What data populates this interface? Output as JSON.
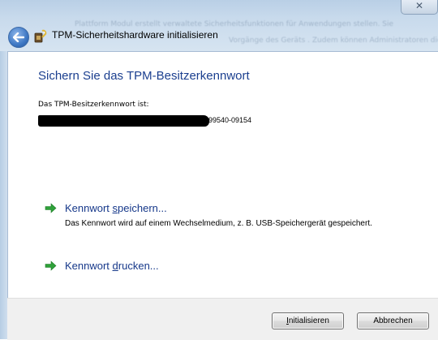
{
  "window": {
    "title": "TPM-Sicherheitshardware initialisieren",
    "background_blur_line1": "Plattform Modul erstellt verwaltete Sicherheitsfunktionen für Anwendungen stellen. Sie",
    "background_blur_line2": "Vorgänge des Geräts . Zudem können Administratoren die die Verwendung"
  },
  "header": {
    "heading": "Sichern Sie das TPM-Besitzerkennwort"
  },
  "password": {
    "label": "Das TPM-Besitzerkennwort ist:",
    "visible_suffix": "99540-09154"
  },
  "commands": [
    {
      "prefix": "Kennwort ",
      "accel": "s",
      "suffix": "peichern...",
      "description": "Das Kennwort wird auf einem Wechselmedium, z. B. USB-Speichergerät gespeichert."
    },
    {
      "prefix": "Kennwort ",
      "accel": "d",
      "suffix": "rucken...",
      "description": ""
    }
  ],
  "footer": {
    "init_accel": "I",
    "init_rest": "nitialisieren",
    "cancel_label": "Abbrechen"
  },
  "colors": {
    "heading": "#1b3f8f",
    "link": "#16388a",
    "arrow": "#2fa13a"
  }
}
